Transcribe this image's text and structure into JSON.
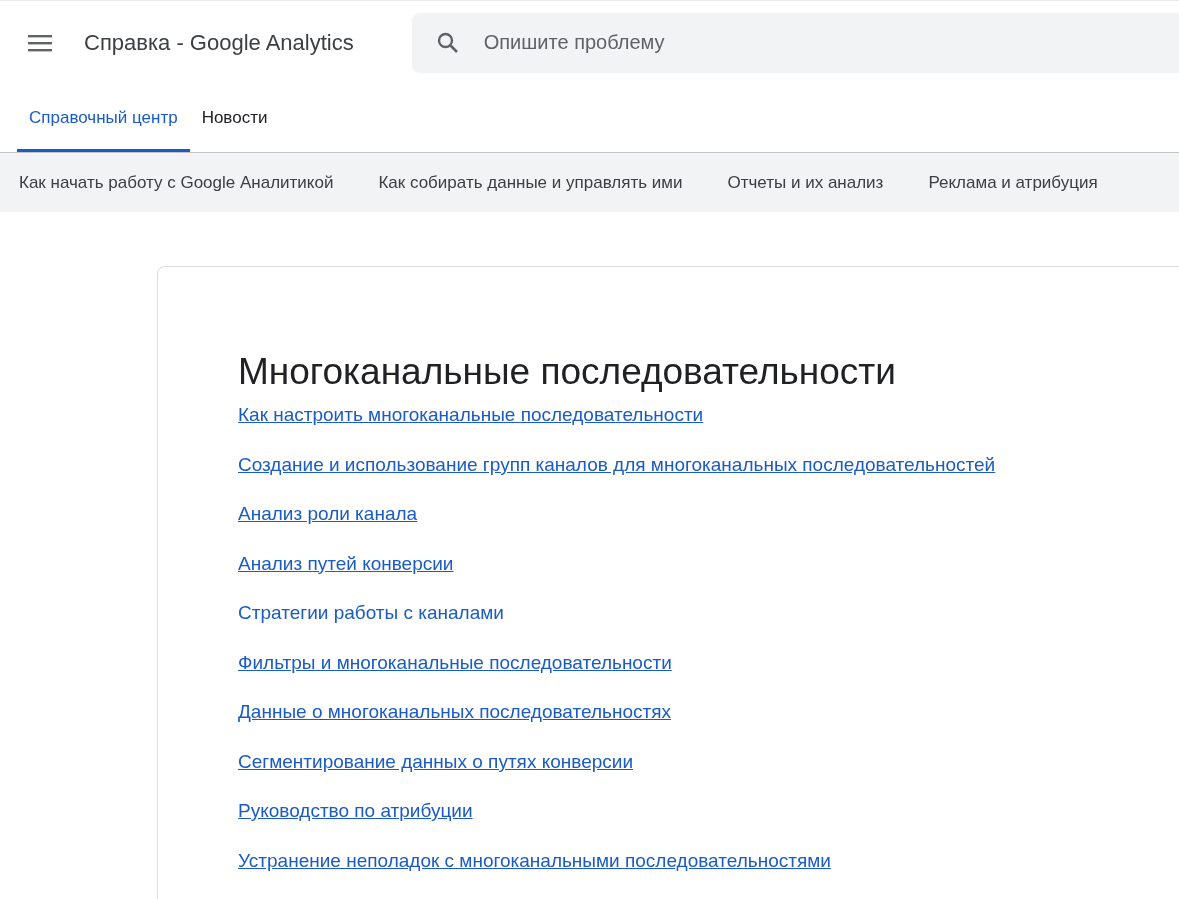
{
  "header": {
    "title": "Справка - Google Analytics",
    "search": {
      "placeholder": "Опишите проблему"
    }
  },
  "tabs": [
    {
      "label": "Справочный центр",
      "selected": true
    },
    {
      "label": "Новости",
      "selected": false
    }
  ],
  "nav": [
    "Как начать работу с Google Аналитикой",
    "Как собирать данные и управлять ими",
    "Отчеты и их анализ",
    "Реклама и атрибуция"
  ],
  "article": {
    "title": "Многоканальные последовательности",
    "links": [
      {
        "text": "Как настроить многоканальные последовательности",
        "underlined": true
      },
      {
        "text": "Создание и использование групп каналов для многоканальных последовательностей",
        "underlined": true
      },
      {
        "text": "Анализ роли канала",
        "underlined": true
      },
      {
        "text": "Анализ путей конверсии",
        "underlined": true
      },
      {
        "text": "Стратегии работы с каналами",
        "underlined": false
      },
      {
        "text": "Фильтры и многоканальные последовательности",
        "underlined": true
      },
      {
        "text": "Данные о многоканальных последовательностях",
        "underlined": true
      },
      {
        "text": "Сегментирование данных о путях конверсии",
        "underlined": true
      },
      {
        "text": "Руководство по атрибуции",
        "underlined": true
      },
      {
        "text": "Устранение неполадок с многоканальными последовательностями",
        "underlined": true
      }
    ]
  }
}
